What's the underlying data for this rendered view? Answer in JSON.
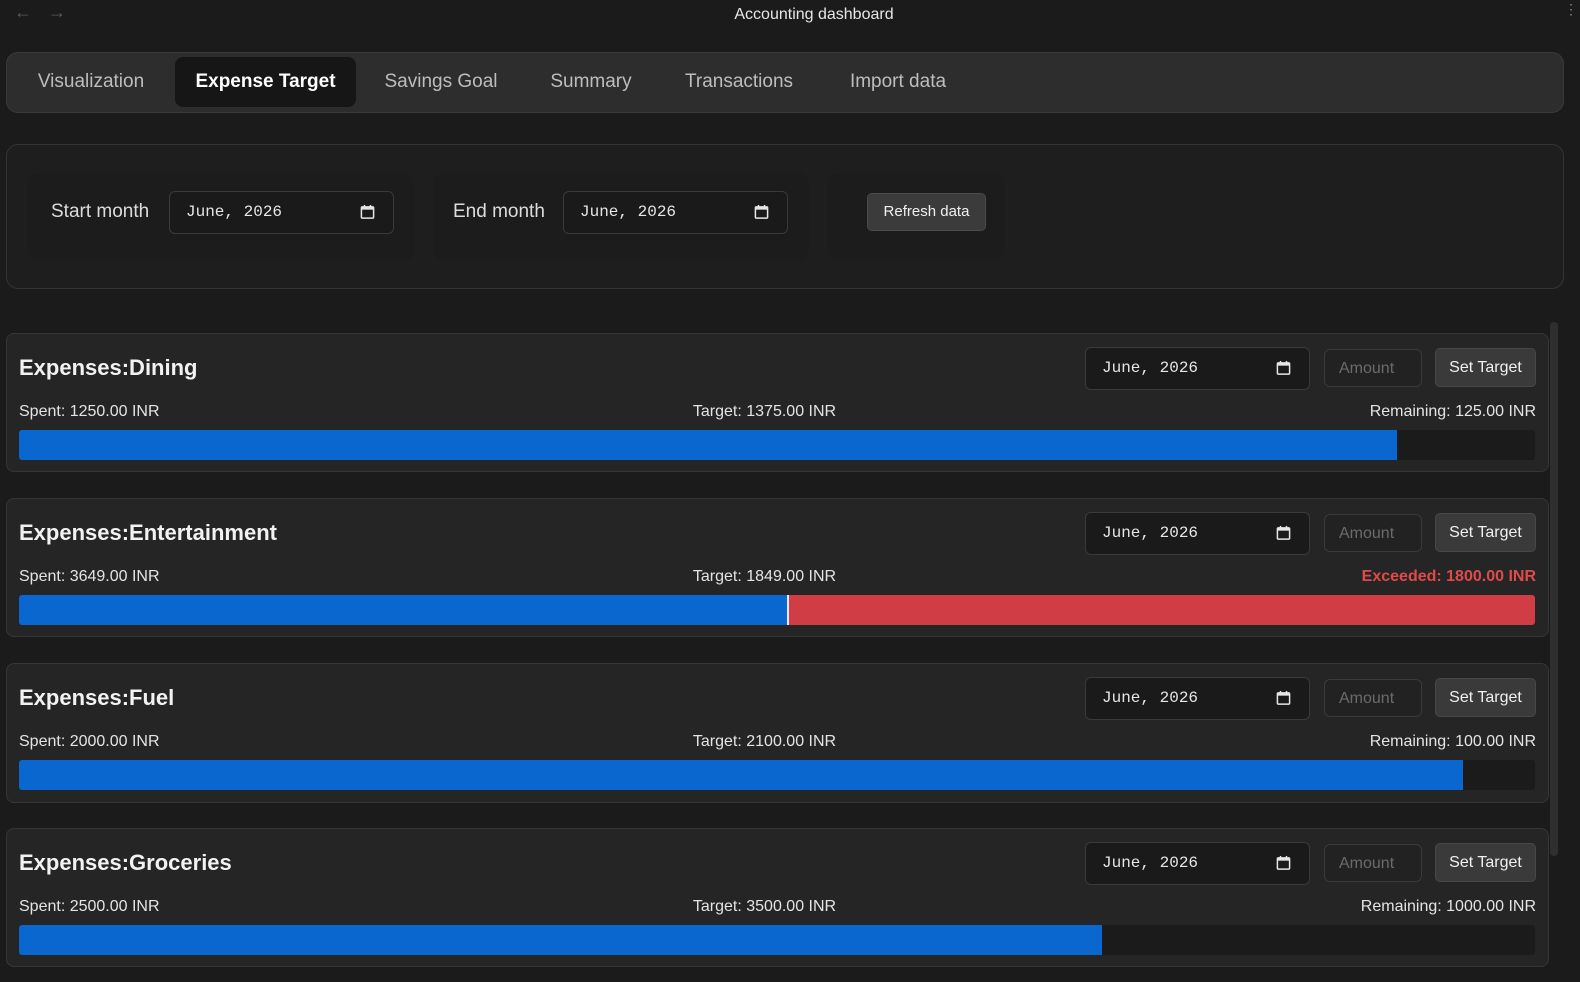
{
  "window": {
    "title": "Accounting dashboard"
  },
  "tabs": [
    {
      "label": "Visualization",
      "active": false
    },
    {
      "label": "Expense Target",
      "active": true
    },
    {
      "label": "Savings Goal",
      "active": false
    },
    {
      "label": "Summary",
      "active": false
    },
    {
      "label": "Transactions",
      "active": false
    },
    {
      "label": "Import data",
      "active": false
    }
  ],
  "filters": {
    "start_label": "Start month",
    "start_value": "June, 2026",
    "end_label": "End month",
    "end_value": "June, 2026",
    "refresh_label": "Refresh data"
  },
  "card_controls": {
    "month_value": "June, 2026",
    "amount_placeholder": "Amount",
    "set_target_label": "Set Target"
  },
  "expenses": [
    {
      "title": "Expenses:Dining",
      "spent": "Spent: 1250.00 INR",
      "target": "Target: 1375.00 INR",
      "status": "Remaining: 125.00 INR",
      "exceeded": false,
      "spent_value": 1250,
      "target_value": 1375
    },
    {
      "title": "Expenses:Entertainment",
      "spent": "Spent: 3649.00 INR",
      "target": "Target: 1849.00 INR",
      "status": "Exceeded: 1800.00 INR",
      "exceeded": true,
      "spent_value": 3649,
      "target_value": 1849
    },
    {
      "title": "Expenses:Fuel",
      "spent": "Spent: 2000.00 INR",
      "target": "Target: 2100.00 INR",
      "status": "Remaining: 100.00 INR",
      "exceeded": false,
      "spent_value": 2000,
      "target_value": 2100
    },
    {
      "title": "Expenses:Groceries",
      "spent": "Spent: 2500.00 INR",
      "target": "Target: 3500.00 INR",
      "status": "Remaining: 1000.00 INR",
      "exceeded": false,
      "spent_value": 2500,
      "target_value": 3500
    }
  ],
  "colors": {
    "progress": "#0b67d0",
    "exceeded": "#d03d45",
    "exceeded_text": "#e04a4a"
  },
  "icons": [
    "back-arrow-icon",
    "forward-arrow-icon",
    "calendar-icon",
    "more-options-icon"
  ]
}
